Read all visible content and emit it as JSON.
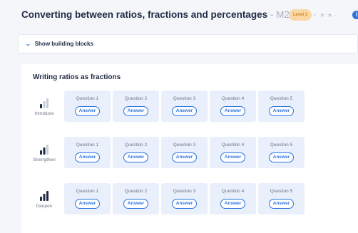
{
  "header": {
    "title": "Converting between ratios, fractions and percentages",
    "separator": " - ",
    "code": "M267",
    "level": "Level 3",
    "rating_icons": "✓ ★ ★ ·",
    "info": "i"
  },
  "building_blocks": {
    "toggle_icon": "chevron-down-icon",
    "label": "Show building blocks"
  },
  "section": {
    "title": "Writing ratios as fractions",
    "rows": [
      {
        "label": "Introduce",
        "level": 1,
        "icon": "signal-bars-icon"
      },
      {
        "label": "Strengthen",
        "level": 2,
        "icon": "signal-bars-icon"
      },
      {
        "label": "Deepen",
        "level": 3,
        "icon": "signal-bars-icon"
      }
    ],
    "questions": [
      "Question 1",
      "Question 2",
      "Question 3",
      "Question 4",
      "Question 5"
    ],
    "answer_label": "Answer"
  },
  "colors": {
    "accent": "#2b74e0",
    "card_bg": "#e9f0fb",
    "level_pill": "#fbd7a3",
    "bar_active": "#1f2a44",
    "bar_inactive": "#c5ccd8"
  }
}
